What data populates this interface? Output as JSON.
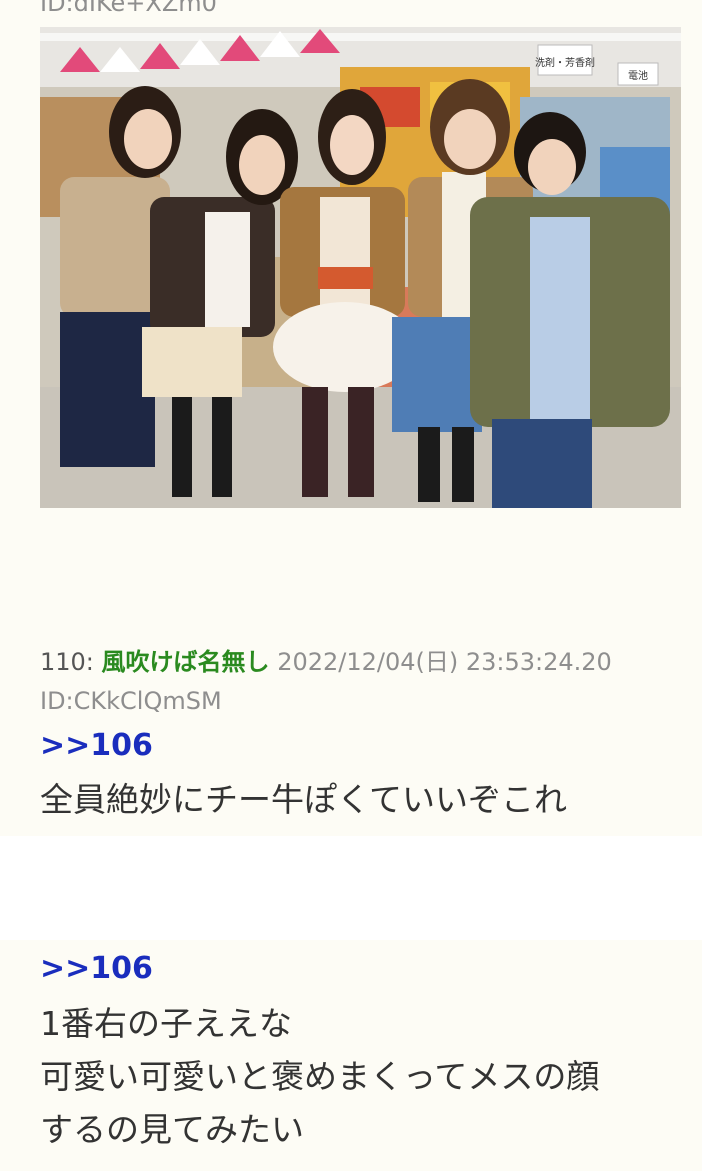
{
  "top_post": {
    "id_line": "ID:dIKe+XZm0",
    "photo": {
      "alt_icon": "group-photo-five-girls-in-store",
      "sign_1": "洗剤・芳香剤",
      "sign_2": "電池"
    }
  },
  "post_110": {
    "number": "110:",
    "name": "風吹けば名無し",
    "datetime": "2022/12/04(日) 23:53:24.20",
    "id_line": "ID:CKkClQmSM",
    "anchor": ">>106",
    "text": "全員絶妙にチー牛ぽくていいぞこれ"
  },
  "post_next": {
    "anchor": ">>106",
    "lines": [
      "1番右の子ええな",
      "可愛い可愛いと褒めまくってメスの顔",
      "するの見てみたい"
    ]
  }
}
